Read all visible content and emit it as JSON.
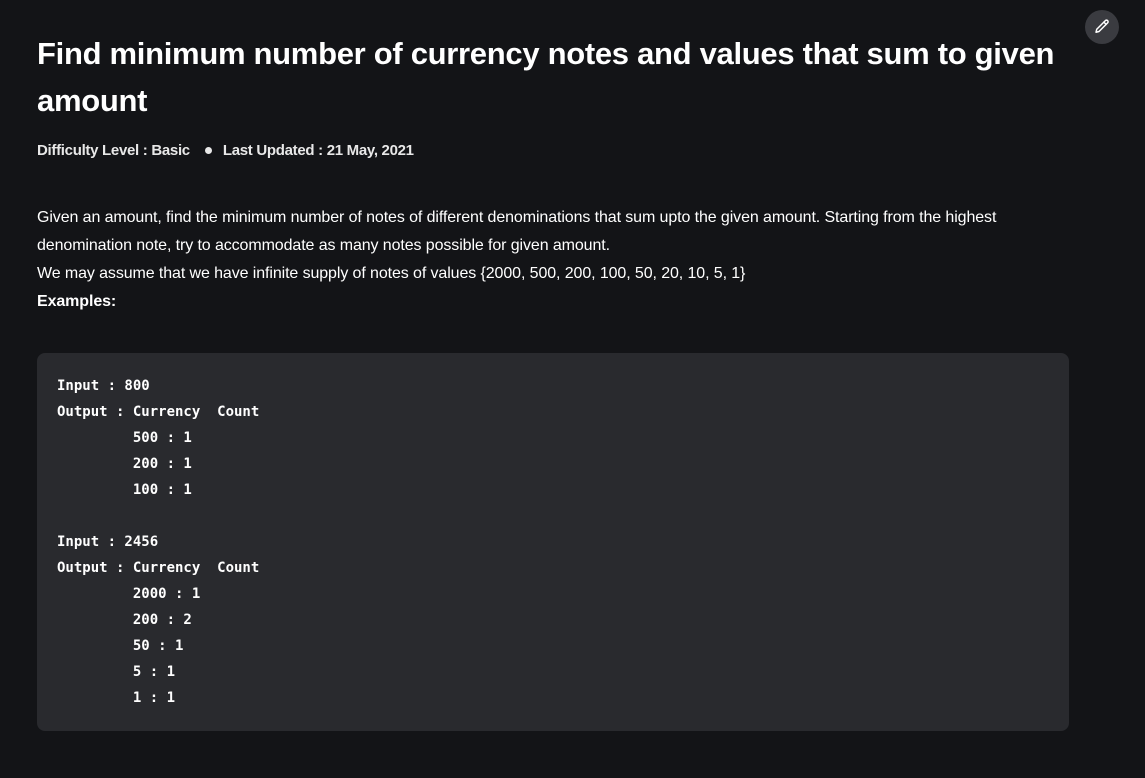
{
  "article": {
    "title": "Find minimum number of currency notes and values that sum to given amount",
    "difficulty": "Difficulty Level : Basic",
    "last_updated": "Last Updated : 21 May, 2021",
    "paragraphs": [
      "Given an amount, find the minimum number of notes of different denominations that sum upto the given amount. Starting from the highest denomination note, try to accommodate as many notes possible for given amount.",
      "We may assume that we have infinite supply of notes of values {2000, 500, 200, 100, 50, 20, 10, 5, 1}"
    ],
    "examples_label": "Examples:",
    "code": "Input : 800\nOutput : Currency  Count \n         500 : 1\n         200 : 1\n         100 : 1\n\nInput : 2456\nOutput : Currency  Count\n         2000 : 1\n         200 : 2\n         50 : 1\n         5 : 1\n         1 : 1"
  },
  "toolbar": {
    "edit_icon": "pencil-icon"
  }
}
